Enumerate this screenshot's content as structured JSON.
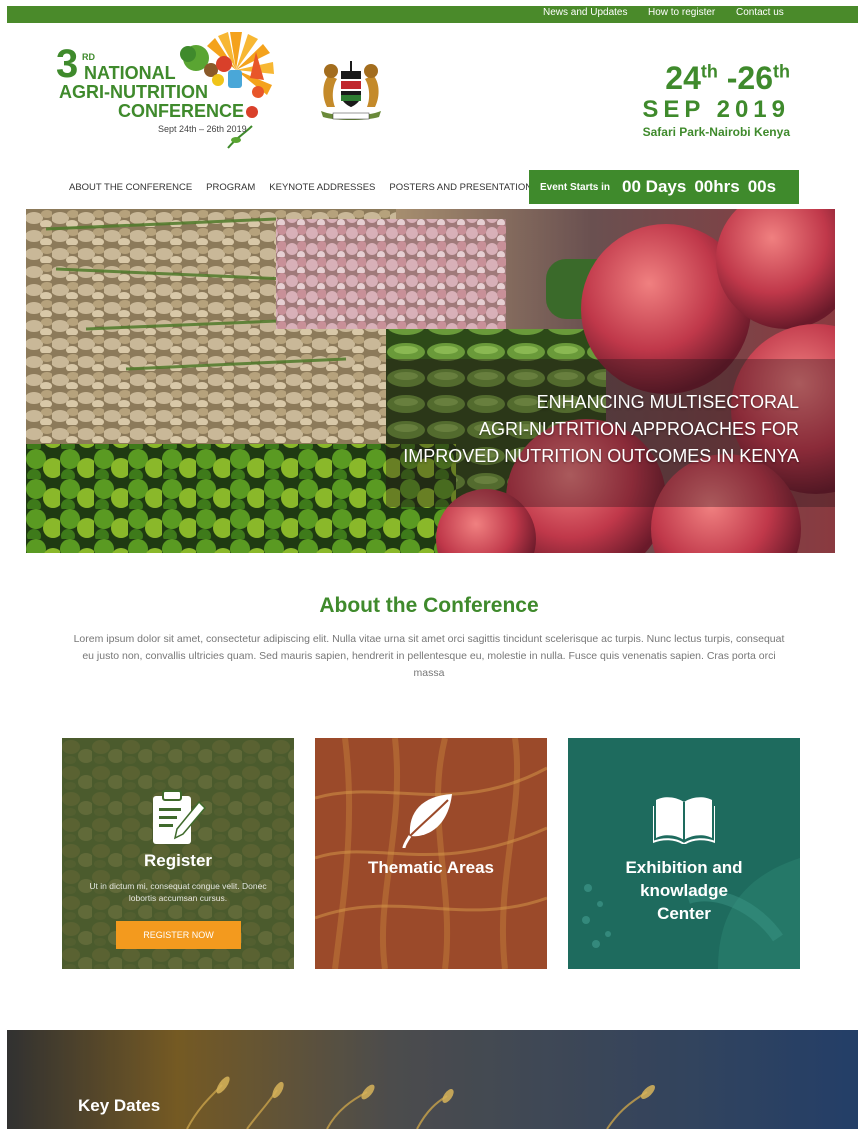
{
  "topbar": {
    "links": [
      "News and Updates",
      "How to register",
      "Contact us"
    ]
  },
  "logo": {
    "number": "3",
    "ordinal": "RD",
    "line1": "NATIONAL",
    "line2": "AGRI-NUTRITION",
    "line3": "CONFERENCE",
    "dates": "Sept 24th – 26th 2019"
  },
  "event_date": {
    "start_day": "24",
    "start_suffix": "th",
    "separator": " -",
    "end_day": "26",
    "end_suffix": "th",
    "month_year": "SEP 2019",
    "venue": "Safari Park-Nairobi Kenya"
  },
  "nav": {
    "items": [
      "ABOUT THE CONFERENCE",
      "PROGRAM",
      "KEYNOTE ADDRESSES",
      "POSTERS AND PRESENTATIONS"
    ]
  },
  "countdown": {
    "label": "Event Starts in",
    "days": "00 Days",
    "hours": "00hrs",
    "seconds": "00s"
  },
  "hero": {
    "tagline_lines": [
      "ENHANCING MULTISECTORAL",
      "AGRI-NUTRITION APPROACHES FOR",
      "IMPROVED NUTRITION OUTCOMES IN KENYA"
    ]
  },
  "about": {
    "title": "About the Conference",
    "text": "Lorem ipsum dolor sit amet, consectetur adipiscing elit. Nulla vitae urna sit amet orci sagittis tincidunt scelerisque ac turpis. Nunc lectus turpis, consequat eu justo non, convallis ultricies quam. Sed mauris sapien, hendrerit in pellentesque eu, molestie in nulla. Fusce quis venenatis sapien. Cras porta orci massa"
  },
  "cards": [
    {
      "title": "Register",
      "subtitle": "Ut in dictum mi, consequat congue velit. Donec lobortis accumsan cursus.",
      "button": "REGISTER NOW",
      "icon": "clipboard-pen-icon"
    },
    {
      "title": "Thematic Areas",
      "icon": "leaf-icon"
    },
    {
      "title_lines": [
        "Exhibition and",
        "knowladge",
        "Center"
      ],
      "icon": "open-book-icon"
    }
  ],
  "keydates": {
    "title": "Key Dates"
  },
  "colors": {
    "brand_green": "#3f8a2c",
    "topbar_green": "#4a8a2a",
    "button_orange": "#f39a1e",
    "card_teal": "#1e6b5e",
    "card_rust": "#9b4a2a"
  }
}
